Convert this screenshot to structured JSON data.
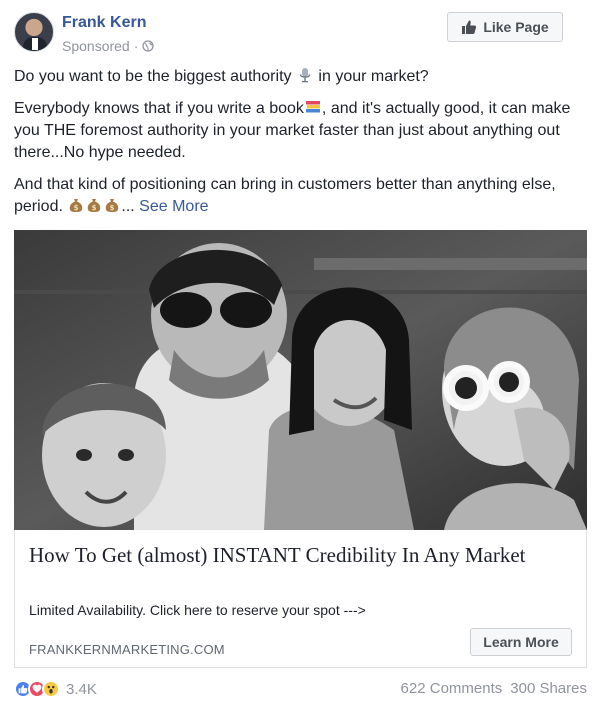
{
  "post": {
    "page_name": "Frank Kern",
    "sponsored_label": "Sponsored",
    "meta_separator": "·",
    "like_page_label": "Like Page",
    "text": {
      "line1_before": "Do you want to be the biggest authority",
      "line1_after": "in your market?",
      "para2_before": "Everybody knows that if you write a book",
      "para2_after": ", and it's actually good, it can make you THE foremost authority in your market faster than just about anything out there...No hype needed.",
      "para3": "And that kind of positioning can bring in customers better than anything else, period.",
      "ellipsis": "...",
      "see_more": "See More"
    },
    "emojis": [
      "microphone-emoji",
      "books-emoji",
      "money-bag-emoji",
      "money-bag-emoji",
      "money-bag-emoji"
    ]
  },
  "link_preview": {
    "title": "How To Get (almost) INSTANT Credibility In Any Market",
    "description": "Limited Availability. Click here to reserve your spot --->",
    "domain": "FRANKKERNMARKETING.COM",
    "cta_label": "Learn More"
  },
  "engagement": {
    "reaction_icons": [
      "like-icon",
      "love-icon",
      "wow-icon"
    ],
    "reaction_count": "3.4K",
    "comments": "622 Comments",
    "shares": "300 Shares"
  },
  "colors": {
    "link_blue": "#365899",
    "meta_gray": "#90949c",
    "like_reaction": "#4d7ff1",
    "love_reaction": "#ee4961",
    "wow_reaction": "#f8c944"
  }
}
